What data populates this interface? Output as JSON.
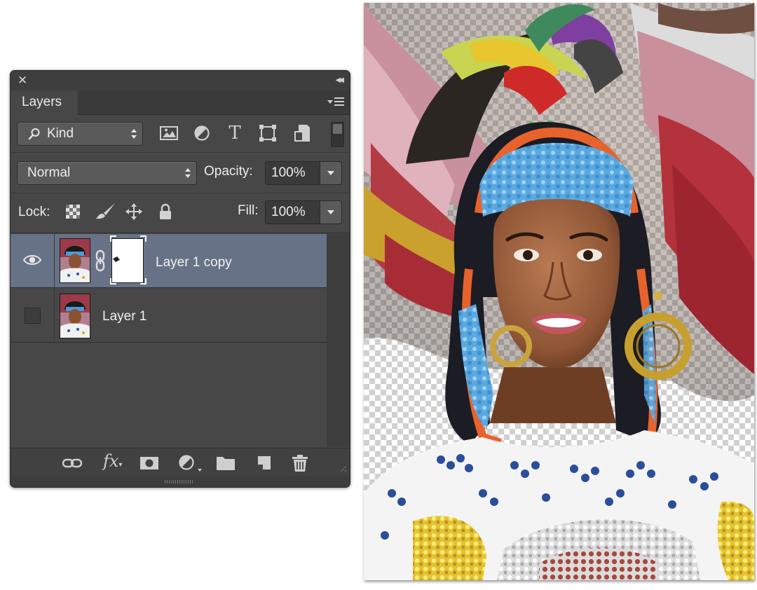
{
  "panel": {
    "tab_label": "Layers",
    "filter": {
      "kind_label": "Kind",
      "icons": [
        "image-filter-icon",
        "adjustment-filter-icon",
        "type-filter-icon",
        "shape-filter-icon",
        "smart-object-filter-icon"
      ],
      "type_glyph": "T"
    },
    "blend": {
      "mode": "Normal",
      "opacity_label": "Opacity:",
      "opacity_value": "100%"
    },
    "lock": {
      "label": "Lock:",
      "icons": [
        "lock-transparent-pixels-icon",
        "lock-image-pixels-icon",
        "lock-position-icon",
        "lock-all-icon"
      ],
      "fill_label": "Fill:",
      "fill_value": "100%"
    },
    "layers": [
      {
        "name": "Layer 1 copy",
        "visible": true,
        "selected": true,
        "has_mask": true
      },
      {
        "name": "Layer 1",
        "visible": false,
        "selected": false,
        "has_mask": false
      }
    ],
    "footer": {
      "icons": [
        "link-layers-icon",
        "fx-icon",
        "add-mask-icon",
        "adjustment-layer-icon",
        "new-group-icon",
        "new-layer-icon",
        "delete-layer-icon"
      ],
      "fx_label": "fx"
    }
  },
  "colors": {
    "panel_bg": "#474747",
    "selected_row": "#677286",
    "text": "#ececec"
  }
}
